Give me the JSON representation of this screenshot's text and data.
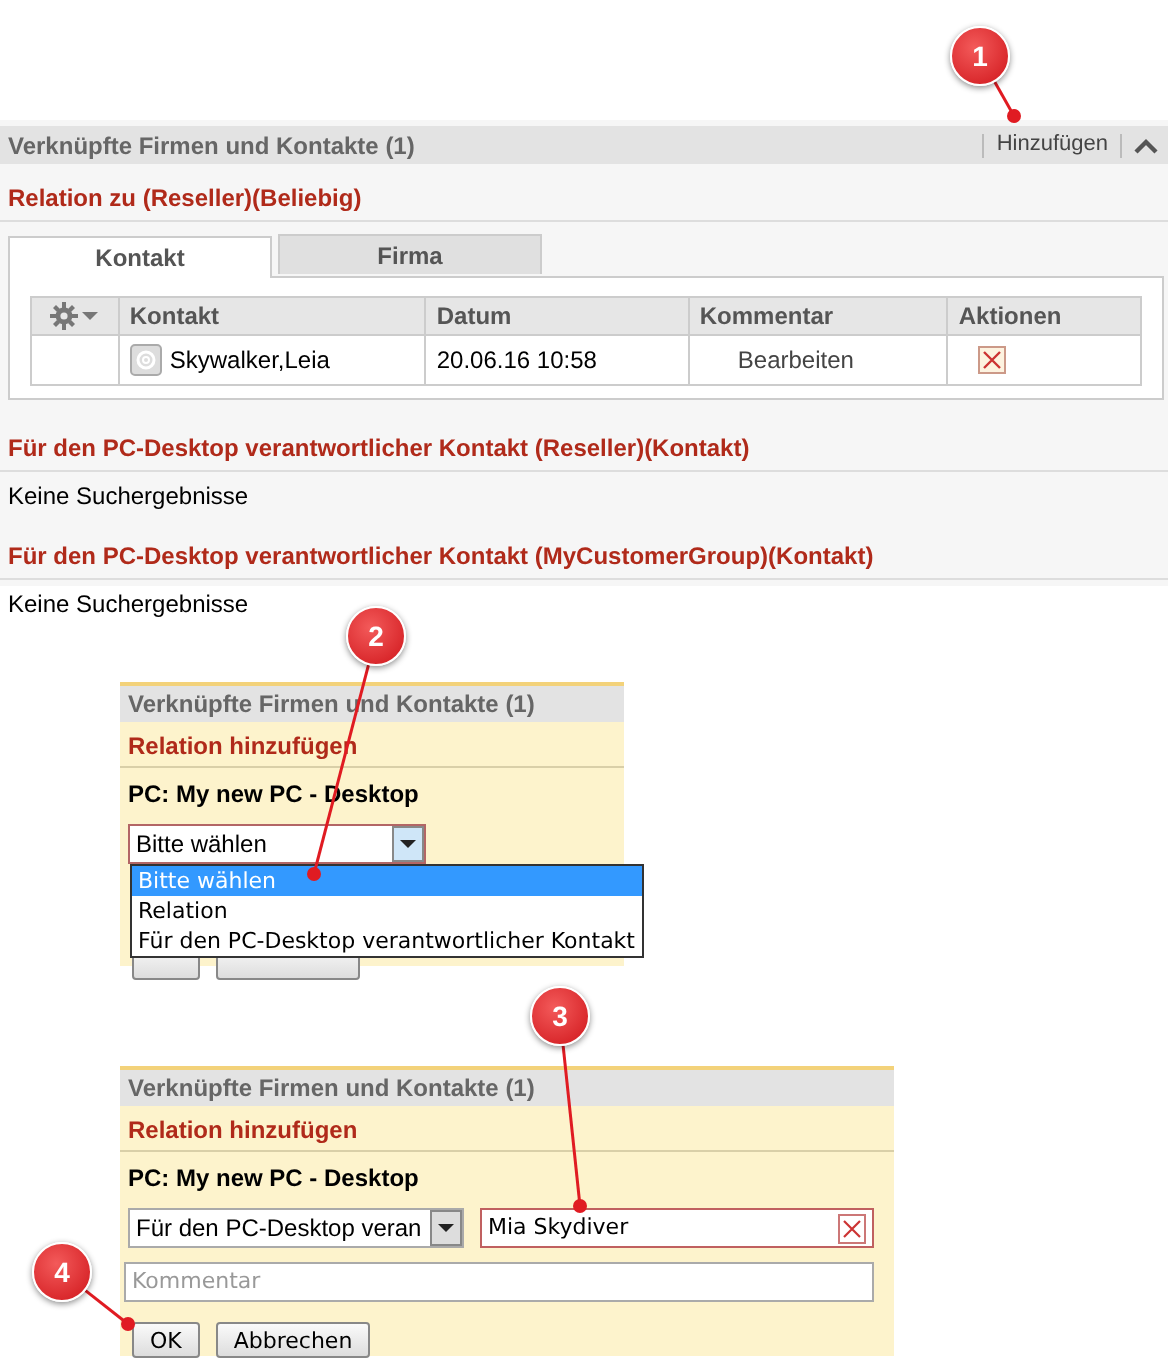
{
  "overview": {
    "title": "Verknüpfte Firmen und Kontakte (1)",
    "add_link": "Hinzufügen",
    "expanded": true,
    "relation_heading": "Relation zu (Reseller)(Beliebig)",
    "tabs": [
      {
        "label": "Kontakt",
        "selected": true
      },
      {
        "label": "Firma",
        "selected": false
      }
    ],
    "table": {
      "columns": [
        "Kontakt",
        "Datum",
        "Kommentar",
        "Aktionen"
      ],
      "rows": [
        {
          "contact": "Skywalker,Leia",
          "date": "20.06.16 10:58",
          "comment_action": "Bearbeiten"
        }
      ]
    },
    "sections": [
      {
        "heading": "Für den PC-Desktop verantwortlicher Kontakt (Reseller)(Kontakt)",
        "text": "Keine Suchergebnisse"
      },
      {
        "heading": "Für den PC-Desktop verantwortlicher Kontakt (MyCustomerGroup)(Kontakt)",
        "text": "Keine Suchergebnisse"
      }
    ]
  },
  "dialogs": [
    {
      "title": "Verknüpfte Firmen und Kontakte (1)",
      "subtitle": "Relation hinzufügen",
      "object_label": "PC: My new PC - Desktop",
      "select": {
        "value": "Bitte wählen",
        "expanded": true,
        "options": [
          {
            "label": "Bitte wählen",
            "selected": true
          },
          {
            "label": "Relation",
            "selected": false
          },
          {
            "label": "Für den PC-Desktop verantwortlicher Kontakt",
            "selected": false
          }
        ]
      }
    },
    {
      "title": "Verknüpfte Firmen und Kontakte (1)",
      "subtitle": "Relation hinzufügen",
      "object_label": "PC: My new PC - Desktop",
      "select": {
        "value": "Für den PC-Desktop veran",
        "expanded": false
      },
      "search_field": {
        "value": "Mia Skydiver"
      },
      "comment_field": {
        "placeholder": "Kommentar"
      },
      "buttons": [
        "OK",
        "Abbrechen"
      ]
    }
  ],
  "callouts": [
    "1",
    "2",
    "3",
    "4"
  ]
}
